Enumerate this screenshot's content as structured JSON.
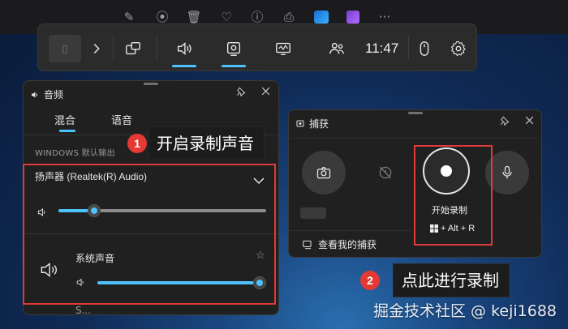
{
  "gamebar": {
    "time": "11:47"
  },
  "audio": {
    "title": "音频",
    "tabs": [
      "混合",
      "语音"
    ],
    "section_label": "WINDOWS 默认输出",
    "device": "扬声器 (Realtek(R) Audio)",
    "device_volume": 0.17,
    "app_name": "系统声音",
    "app_volume": 1.0,
    "partial_next_label": "S..."
  },
  "capture": {
    "title": "捕获",
    "start_recording": "开始录制",
    "shortcut": "+ Alt + R",
    "view_captures": "查看我的捕获"
  },
  "callouts": [
    {
      "number": "1",
      "text": "开启录制声音"
    },
    {
      "number": "2",
      "text": "点此进行录制"
    }
  ],
  "watermark": "掘金技术社区 @ keji1688",
  "colors": {
    "accent": "#4cc2ff",
    "highlight": "#e03a3a",
    "badge": "#e53935"
  }
}
